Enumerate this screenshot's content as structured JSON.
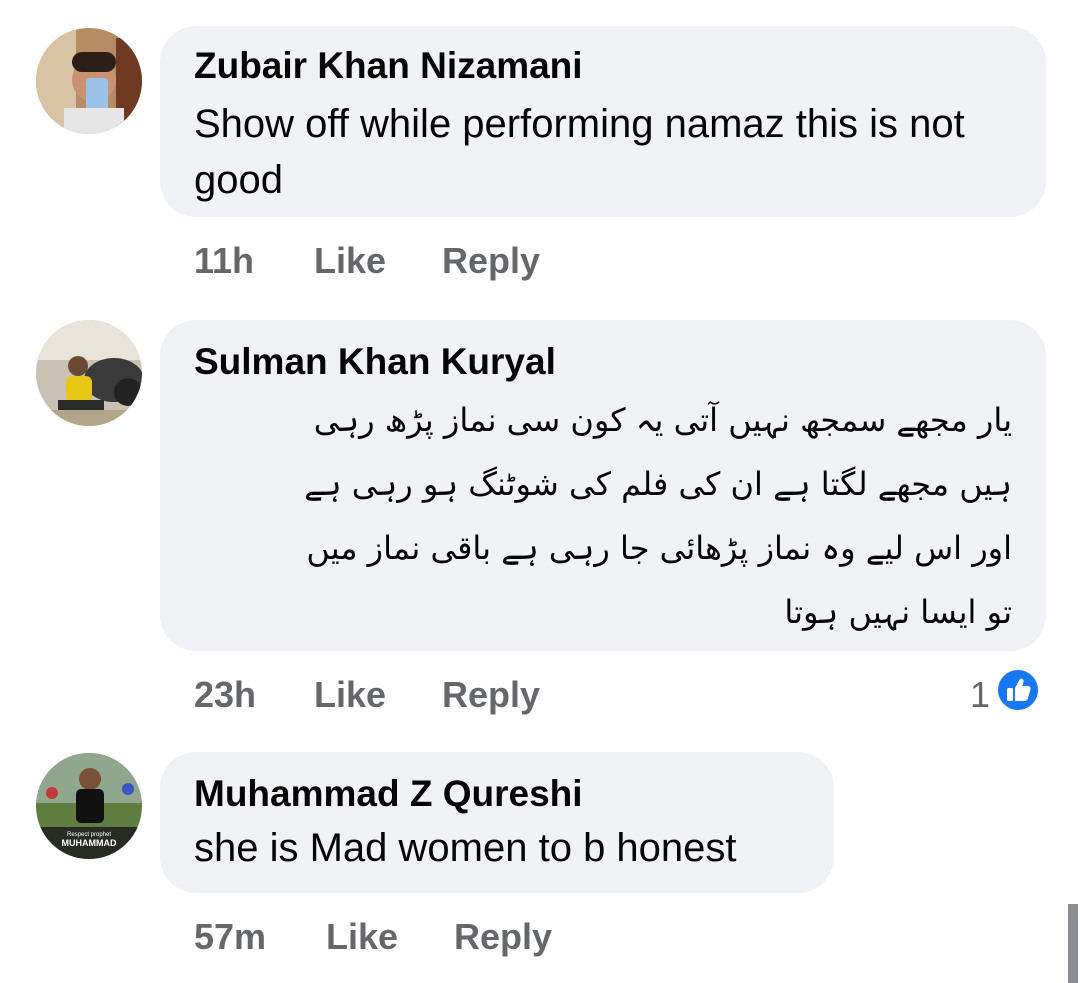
{
  "comments": [
    {
      "author": "Zubair Khan Nizamani",
      "text": "Show off while performing namaz this is not good",
      "time": "11h",
      "like_label": "Like",
      "reply_label": "Reply"
    },
    {
      "author": "Sulman Khan Kuryal",
      "text_lines": [
        "یار مجھے سمجھ نہیں آتی یہ کون سی نماز پڑھ رہی",
        "ہیں مجھے لگتا ہے ان کی فلم کی شوٹنگ ہو رہی ہے",
        "اور اس لیے وہ نماز پڑھائی جا رہی ہے باقی نماز میں",
        "تو ایسا نہیں ہوتا"
      ],
      "time": "23h",
      "like_label": "Like",
      "reply_label": "Reply",
      "reaction_count": "1",
      "reaction_icon": "thumbs-up-icon",
      "reaction_color": "#1877f2"
    },
    {
      "author": "Muhammad Z Qureshi",
      "text": "she is Mad women to b honest",
      "time": "57m",
      "like_label": "Like",
      "reply_label": "Reply",
      "avatar_caption_1": "Respect prophet",
      "avatar_caption_2": "MUHAMMAD"
    }
  ]
}
